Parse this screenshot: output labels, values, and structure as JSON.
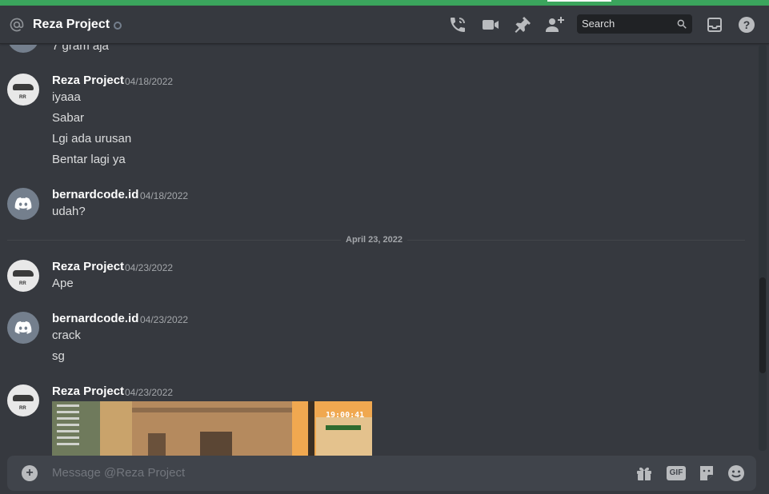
{
  "header": {
    "title": "Reza Project",
    "search_placeholder": "Search",
    "icons": [
      "at-icon",
      "start-voice-call-icon",
      "start-video-call-icon",
      "pinned-messages-icon",
      "add-friends-to-dm-icon",
      "search-icon",
      "inbox-icon",
      "help-icon"
    ]
  },
  "messages": {
    "partial_top": "7 gram aja",
    "groups": [
      {
        "author": "Reza Project",
        "timestamp": "04/18/2022",
        "lines": [
          "iyaaa",
          "Sabar",
          "Lgi ada urusan",
          "Bentar lagi ya"
        ]
      },
      {
        "author": "bernardcode.id",
        "timestamp": "04/18/2022",
        "lines": [
          "udah?"
        ]
      },
      {
        "author": "Reza Project",
        "timestamp": "04/23/2022",
        "lines": [
          "Ape"
        ]
      },
      {
        "author": "bernardcode.id",
        "timestamp": "04/23/2022",
        "lines": [
          "crack",
          "sg"
        ]
      },
      {
        "author": "Reza Project",
        "timestamp": "04/23/2022",
        "lines": []
      }
    ],
    "date_divider": "April 23, 2022",
    "image_attachment": {
      "clock_text": "19:00:41"
    }
  },
  "composer": {
    "placeholder": "Message @Reza Project",
    "icons": [
      "upload-plus-icon",
      "gift-icon",
      "gif-icon",
      "sticker-icon",
      "emoji-icon"
    ],
    "gif_label": "GIF"
  },
  "colors": {
    "background": "#36393f",
    "composer": "#40444b",
    "accent_green": "#3ba55d",
    "username": "#ffffff",
    "text": "#dcddde",
    "muted": "#a3a6aa"
  }
}
